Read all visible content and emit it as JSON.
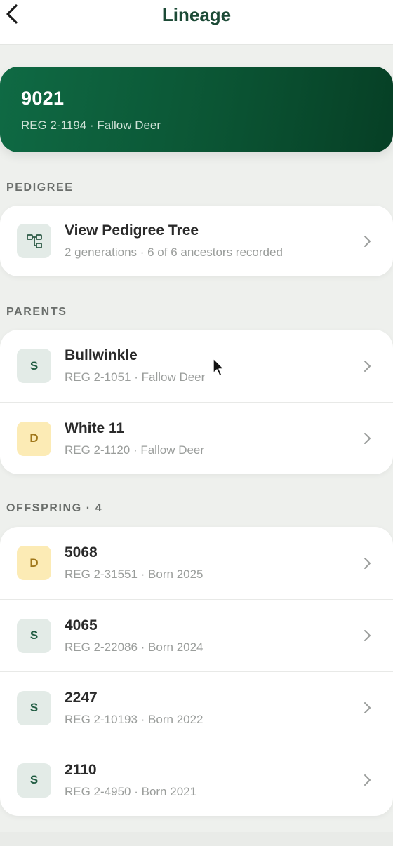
{
  "header": {
    "title": "Lineage"
  },
  "animal": {
    "name": "9021",
    "subtitle": "REG 2-1194 · Fallow Deer"
  },
  "pedigree": {
    "section_label": "PEDIGREE",
    "title": "View Pedigree Tree",
    "subtitle": "2 generations · 6 of 6 ancestors recorded",
    "icon": "pedigree-tree-icon"
  },
  "parents": {
    "section_label": "PARENTS",
    "items": [
      {
        "badge": "S",
        "name": "Bullwinkle",
        "subtitle": "REG 2-1051 · Fallow Deer"
      },
      {
        "badge": "D",
        "name": "White 11",
        "subtitle": "REG 2-1120 · Fallow Deer"
      }
    ]
  },
  "offspring": {
    "section_label": "OFFSPRING · 4",
    "items": [
      {
        "badge": "D",
        "name": "5068",
        "subtitle": "REG 2-31551 · Born 2025"
      },
      {
        "badge": "S",
        "name": "4065",
        "subtitle": "REG 2-22086 · Born 2024"
      },
      {
        "badge": "S",
        "name": "2247",
        "subtitle": "REG 2-10193 · Born 2022"
      },
      {
        "badge": "S",
        "name": "2110",
        "subtitle": "REG 2-4950 · Born 2021"
      }
    ]
  },
  "colors": {
    "brand_green": "#0b5534",
    "title_green": "#1c4a36",
    "sire_badge_bg": "#e3ebe7",
    "dam_badge_bg": "#fcebb5"
  }
}
